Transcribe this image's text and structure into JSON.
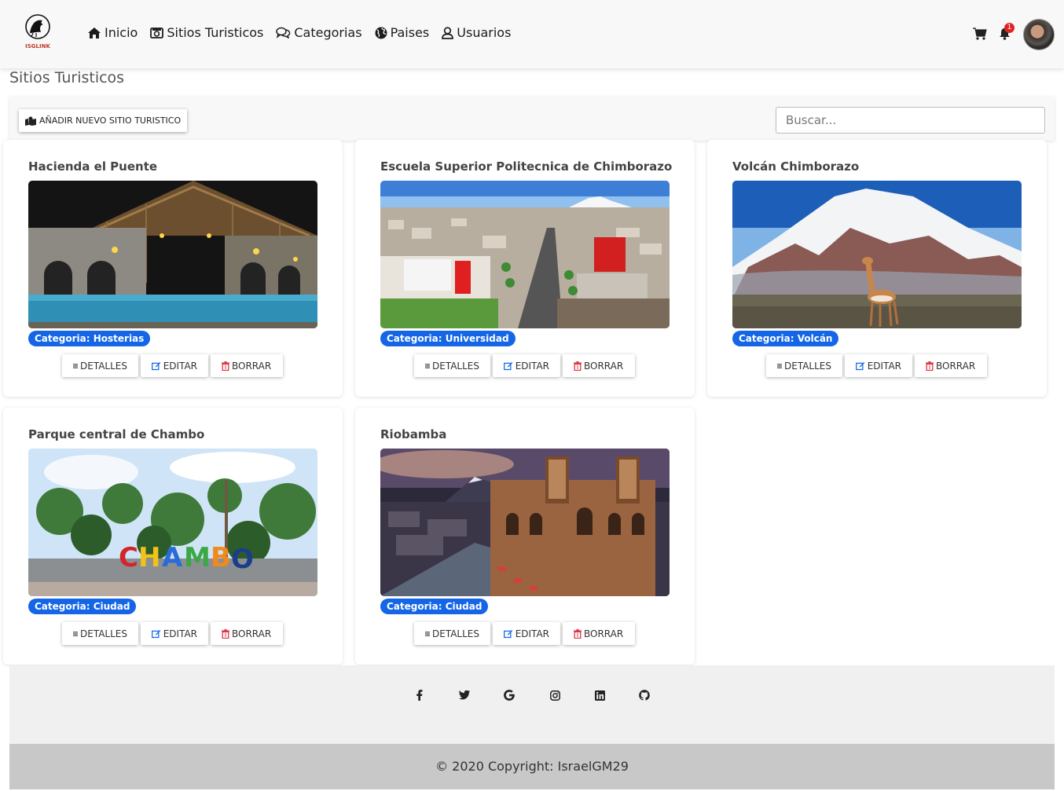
{
  "nav": {
    "logo_text": "ISGLINK",
    "links": [
      {
        "label": "Inicio",
        "icon": "home-icon"
      },
      {
        "label": "Sitios Turisticos",
        "icon": "camera-icon"
      },
      {
        "label": "Categorias",
        "icon": "comments-icon"
      },
      {
        "label": "Paises",
        "icon": "globe-icon"
      },
      {
        "label": "Usuarios",
        "icon": "user-icon"
      }
    ],
    "notifications_count": "1"
  },
  "page": {
    "title": "Sitios Turisticos",
    "add_button_label": "AÑADIR NUEVO SITIO TURISTICO",
    "search_placeholder": "Buscar..."
  },
  "actions": {
    "details": "DETALLES",
    "edit": "EDITAR",
    "delete": "BORRAR"
  },
  "sites": [
    {
      "title": "Hacienda el Puente",
      "category": "Categoria: Hosterias"
    },
    {
      "title": "Escuela Superior Politecnica de Chimborazo",
      "category": "Categoria: Universidad"
    },
    {
      "title": "Volcán Chimborazo",
      "category": "Categoria: Volcán"
    },
    {
      "title": "Parque central de Chambo",
      "category": "Categoria: Ciudad"
    },
    {
      "title": "Riobamba",
      "category": "Categoria: Ciudad"
    }
  ],
  "footer": {
    "social_icons": [
      "facebook-icon",
      "twitter-icon",
      "google-icon",
      "instagram-icon",
      "linkedin-icon",
      "github-icon"
    ],
    "copyright": "© 2020 Copyright: IsraelGM29"
  },
  "colors": {
    "badge": "#1466e6",
    "edit": "#1466e6",
    "delete": "#dc3545"
  }
}
